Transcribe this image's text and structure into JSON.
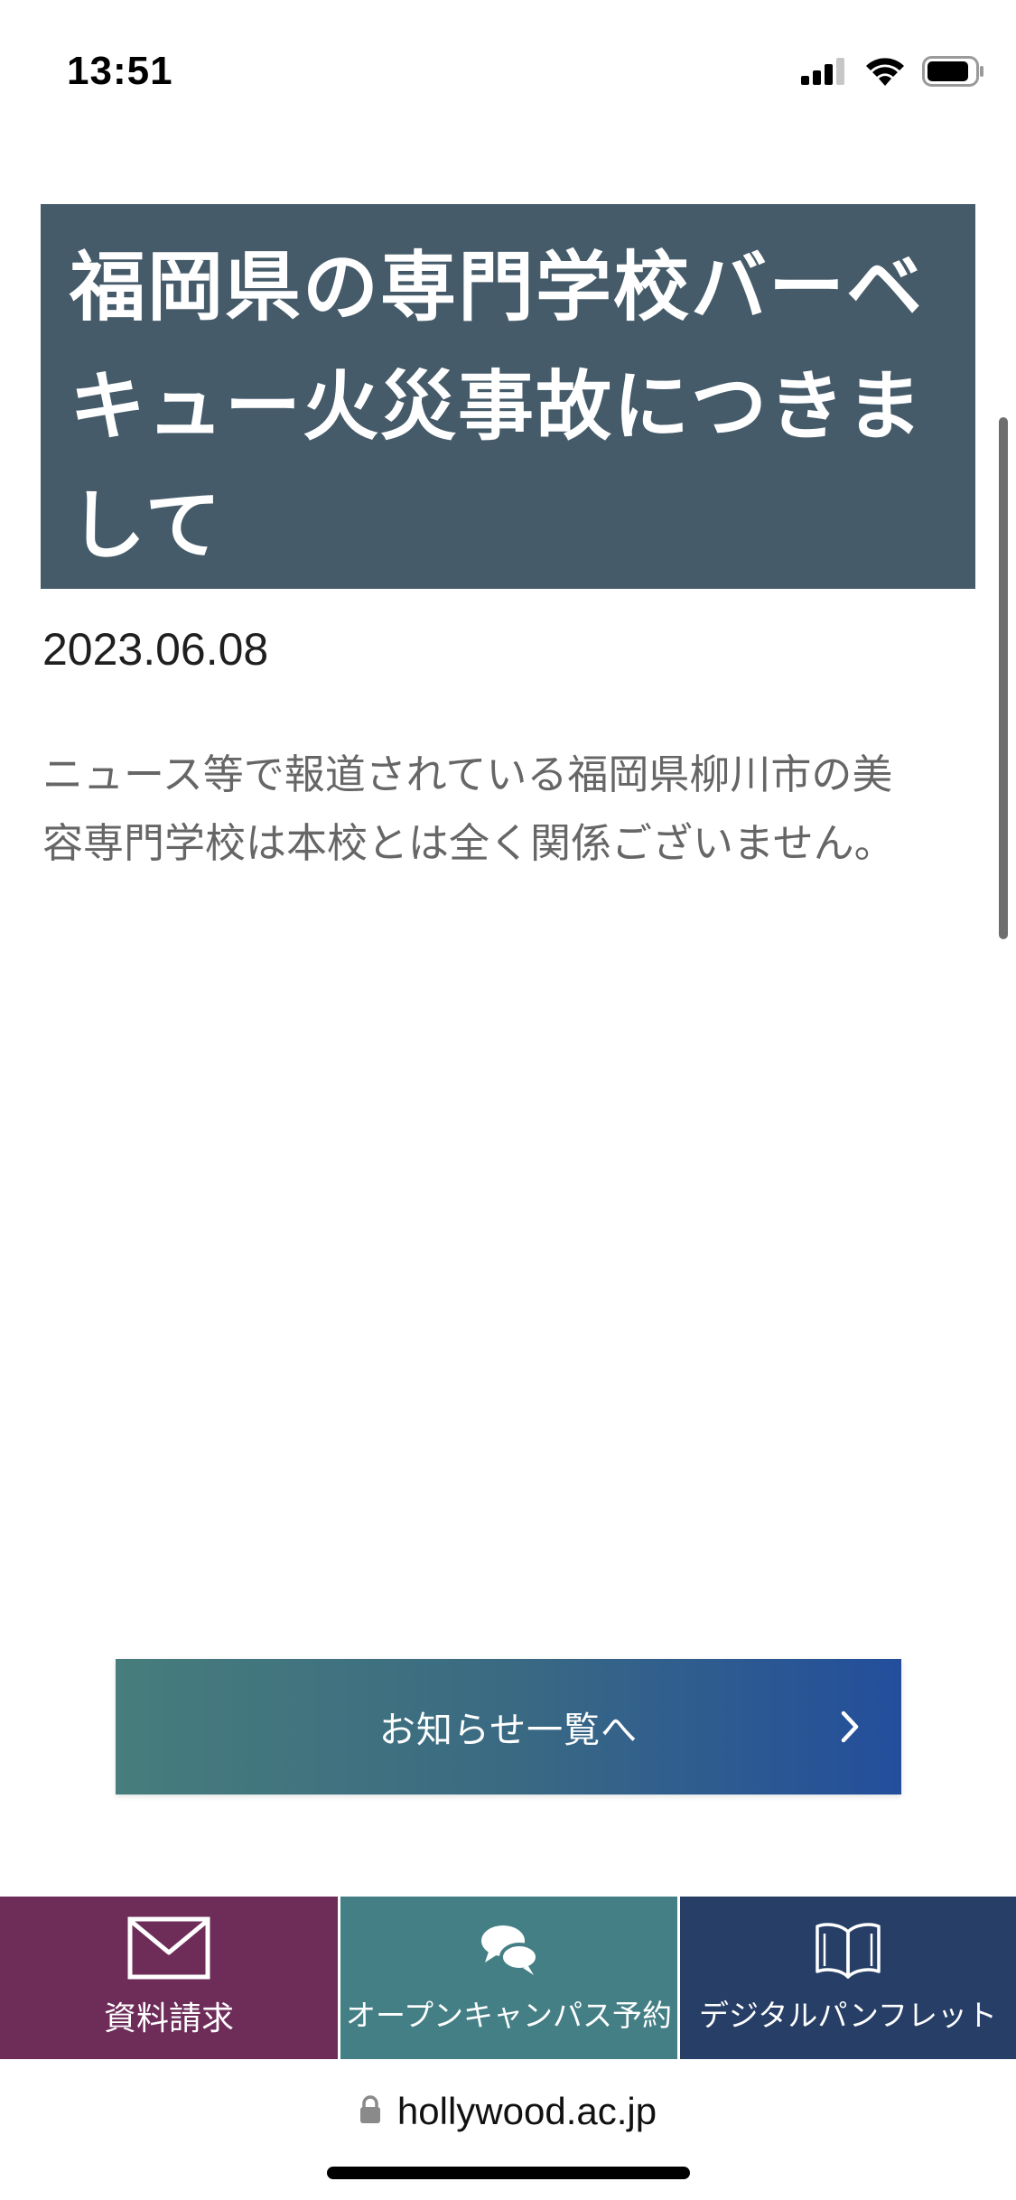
{
  "status_bar": {
    "time": "13:51"
  },
  "article": {
    "title_line1": "福岡県の専門学校バーベ",
    "title_line2": "キュー火災事故につきま",
    "title_line3": "して",
    "date": "2023.06.08",
    "body_line1": "ニュース等で報道されている福岡県柳川市の美",
    "body_line2": "容専門学校は本校とは全く関係ございません。"
  },
  "news_list_button": {
    "label": "お知らせ一覧へ"
  },
  "bottom_nav": {
    "items": [
      {
        "label": "資料請求",
        "icon": "envelope-icon",
        "color": "#6e2c59"
      },
      {
        "label": "オープンキャンパス予約",
        "icon": "chat-bubbles-icon",
        "color": "#447f85"
      },
      {
        "label": "デジタルパンフレット",
        "icon": "open-book-icon",
        "color": "#273f66"
      }
    ]
  },
  "url_bar": {
    "domain": "hollywood.ac.jp"
  },
  "colors": {
    "title_bg": "#455b69",
    "button_gradient_start": "#477d7c",
    "button_gradient_end": "#234e9c"
  }
}
